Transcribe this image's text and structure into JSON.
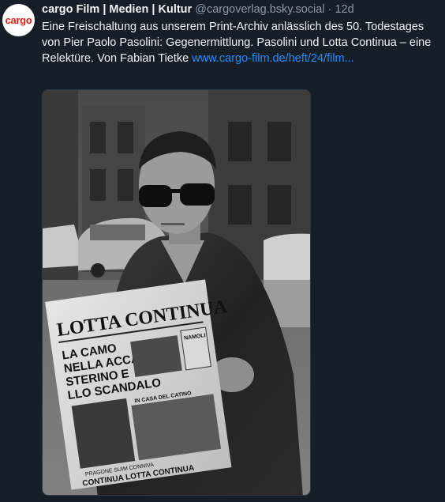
{
  "author": {
    "avatar_text": "cargo",
    "display_name": "cargo Film | Medien | Kultur",
    "handle": "@cargoverlag.bsky.social",
    "separator": "·",
    "time_ago": "12d"
  },
  "post": {
    "text": "Eine Freischaltung aus unserem Print-Archiv anlässlich des 50. Todestages von Pier Paolo Pasolini: Gegenermittlung. Pasolini und Lotta Continua – eine Relektüre. Von Fabian Tietke ",
    "link_text": "www.cargo-film.de/heft/24/film..."
  },
  "media": {
    "newspaper_masthead": "LOTTA CONTINUA",
    "headline_line1": "LA CAMO",
    "headline_line2": "NELLA ACCA",
    "headline_line3": "STERINO E",
    "headline_line4": "LLO SCANDALO",
    "side_box": "NAMOLI",
    "caption_small": "IN CASA DEL CATINO",
    "footer_small": "PRAGONE SUIM CONNIVA",
    "footer_big": "CONTINUA LOTTA CONTINUA"
  }
}
